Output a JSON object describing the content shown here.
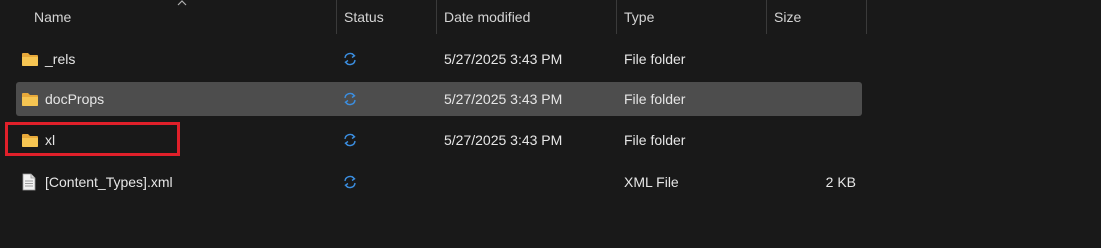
{
  "columns": {
    "name": "Name",
    "status": "Status",
    "date_modified": "Date modified",
    "type": "Type",
    "size": "Size"
  },
  "rows": [
    {
      "name": "_rels",
      "icon": "folder-icon",
      "status": "sync-icon",
      "date": "5/27/2025 3:43 PM",
      "type": "File folder",
      "size": ""
    },
    {
      "name": "docProps",
      "icon": "folder-icon",
      "status": "sync-icon",
      "date": "5/27/2025 3:43 PM",
      "type": "File folder",
      "size": "",
      "selected": true
    },
    {
      "name": "xl",
      "icon": "folder-icon",
      "status": "sync-icon",
      "date": "5/27/2025 3:43 PM",
      "type": "File folder",
      "size": "",
      "highlighted": true
    },
    {
      "name": "[Content_Types].xml",
      "icon": "xml-file-icon",
      "status": "sync-icon",
      "date": "",
      "type": "XML File",
      "size": "2 KB"
    }
  ],
  "colors": {
    "background": "#191919",
    "selected_row": "#4d4d4d",
    "folder": "#f3c04b",
    "sync": "#3b8ee0",
    "highlight": "#e0202a"
  }
}
